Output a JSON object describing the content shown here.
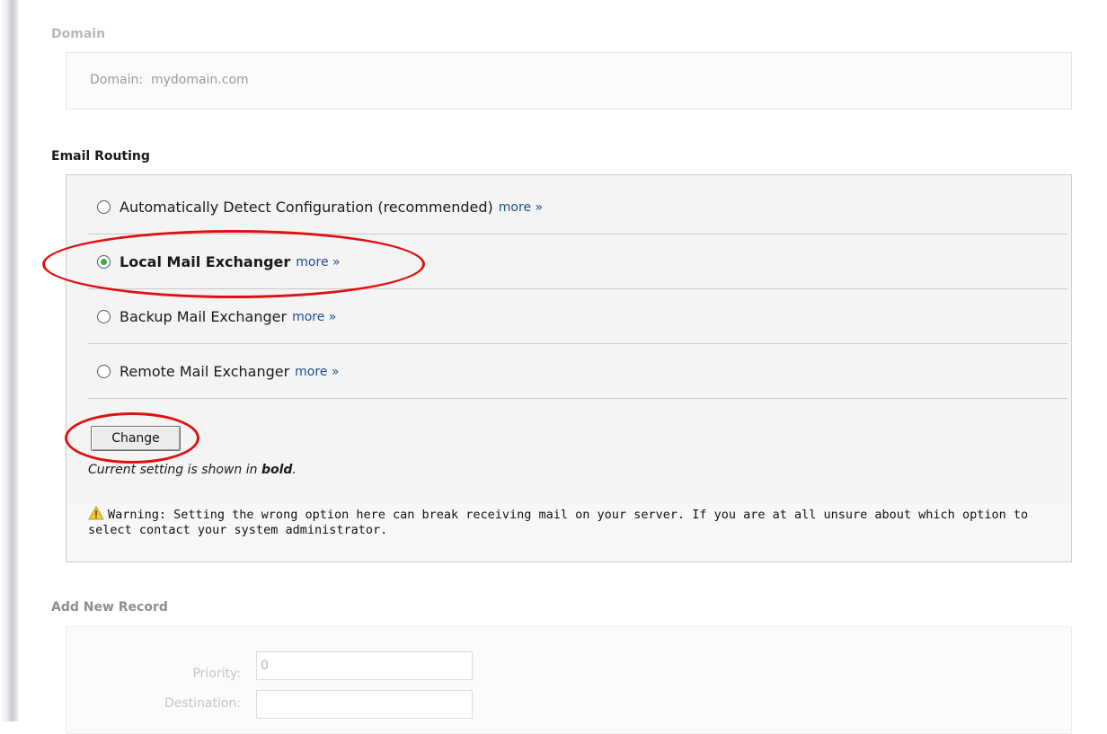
{
  "domain_section": {
    "title": "Domain",
    "label": "Domain:",
    "value": "mydomain.com"
  },
  "routing": {
    "title": "Email Routing",
    "options": [
      {
        "label": "Automatically Detect Configuration (recommended)",
        "more": "more »",
        "selected": false
      },
      {
        "label": "Local Mail Exchanger",
        "more": "more »",
        "selected": true
      },
      {
        "label": "Backup Mail Exchanger",
        "more": "more »",
        "selected": false
      },
      {
        "label": "Remote Mail Exchanger",
        "more": "more »",
        "selected": false
      }
    ],
    "change_label": "Change",
    "note_prefix": "Current setting is shown in ",
    "note_bold": "bold",
    "note_suffix": ".",
    "warning": "Warning: Setting the wrong option here can break receiving mail on your server. If you are at all unsure about which option to select contact your system administrator."
  },
  "add_record": {
    "title": "Add New Record",
    "priority_label": "Priority:",
    "priority_value": "0",
    "destination_label": "Destination:",
    "destination_value": ""
  },
  "colors": {
    "highlight": "#e01010",
    "link": "#1d4f8a",
    "radio_check": "#3fae3f"
  }
}
